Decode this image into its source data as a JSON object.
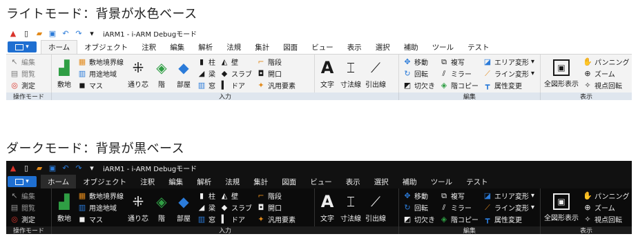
{
  "headings": {
    "light": "ライトモード：背景が水色ベース",
    "dark": "ダークモード：背景が黒ベース"
  },
  "window_title": "iARM1 - i-ARM Debugモード",
  "tabs": [
    "ホーム",
    "オブジェクト",
    "注釈",
    "編集",
    "解析",
    "法規",
    "集計",
    "図面",
    "ビュー",
    "表示",
    "選択",
    "補助",
    "ツール",
    "テスト"
  ],
  "panels": {
    "mode": {
      "items": [
        "編集",
        "閲覧",
        "測定"
      ],
      "footer": "操作モード"
    },
    "input": {
      "large": [
        "敷地",
        "通り芯",
        "階",
        "部屋"
      ],
      "col1": [
        "敷地境界線",
        "用途地域",
        "マス"
      ],
      "col2": [
        "柱",
        "梁",
        "窓"
      ],
      "col3": [
        "壁",
        "スラブ",
        "ドア"
      ],
      "col4": [
        "階段",
        "開口",
        "汎用要素"
      ],
      "footer": "入力"
    },
    "annotate": {
      "large": [
        "文字",
        "寸法線",
        "引出線"
      ]
    },
    "edit": {
      "col1": [
        "移動",
        "回転",
        "切欠き"
      ],
      "col2": [
        "複写",
        "ミラー",
        "階コピー"
      ],
      "col3": [
        "エリア変形",
        "ライン変形",
        "属性変更"
      ],
      "footer": "編集"
    },
    "view": {
      "large": "全図形表示",
      "col": [
        "パンニング",
        "ズーム",
        "視点回転"
      ],
      "footer": "表示"
    }
  },
  "colors": {
    "accent": "#1f6fd1",
    "light_footer": "#dfe6ee",
    "dark_bg": "#0b0b0b"
  },
  "icons": {
    "qat": [
      "app-logo-icon",
      "new-file-icon",
      "open-folder-icon",
      "save-icon",
      "undo-icon",
      "redo-icon",
      "customize-qat-icon"
    ],
    "mode": [
      "edit-pointer-icon",
      "browse-icon",
      "measure-icon"
    ]
  }
}
